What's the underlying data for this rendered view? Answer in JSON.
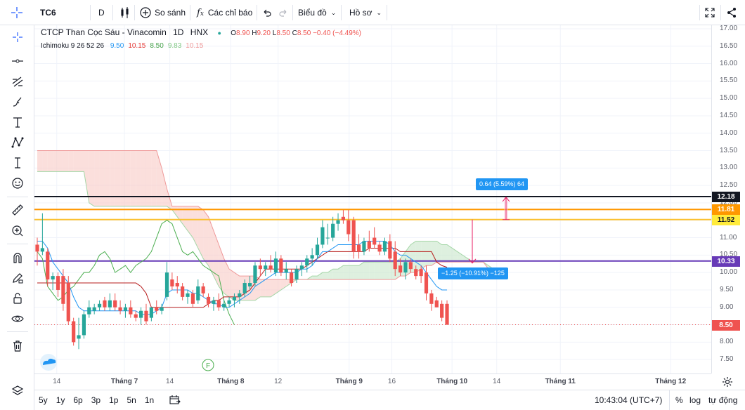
{
  "toolbar": {
    "symbol": "TC6",
    "interval": "D",
    "compare_label": "So sánh",
    "indicators_label": "Các chỉ báo",
    "chart_menu_label": "Biểu đồ",
    "profile_menu_label": "Hồ sơ"
  },
  "legend": {
    "title": "CTCP Than Cọc Sáu - Vinacomin",
    "interval": "1D",
    "exchange": "HNX",
    "ohlc": {
      "o_key": "O",
      "o": "8.90",
      "h_key": "H",
      "h": "9.20",
      "l_key": "L",
      "l": "8.50",
      "c_key": "C",
      "c": "8.50",
      "change": "−0.40 (−4.49%)"
    },
    "indicator_name": "Ichimoku 9 26 52 26",
    "indicator_values": [
      "9.50",
      "10.15",
      "8.50",
      "9.83",
      "10.15"
    ],
    "indicator_colors": [
      "#2196f3",
      "#e53935",
      "#43a047",
      "#81c784",
      "#ef9a9a"
    ]
  },
  "colors": {
    "up": "#26a69a",
    "down": "#ef5350",
    "conversion_line": "#2196f3",
    "base_line": "#b71c1c",
    "lagging_span": "#4caf50",
    "cloud_bear": "#f8c9c4",
    "cloud_bull": "#c8e6c9",
    "line_black": "#131722",
    "line_orange": "#ff9800",
    "line_yellow": "#ffeb3b",
    "line_purple": "#673ab7",
    "measure_blue": "#2196f3",
    "measure_pink": "#e91e63"
  },
  "chart_data": {
    "type": "candlestick",
    "symbol": "TC6",
    "ylim": [
      7.1,
      17.1
    ],
    "price_ticks": [
      "17.00",
      "16.50",
      "16.00",
      "15.50",
      "15.00",
      "14.50",
      "14.00",
      "13.50",
      "13.00",
      "12.50",
      "12.00",
      "11.50",
      "11.00",
      "10.50",
      "10.00",
      "9.50",
      "9.00",
      "8.50",
      "8.00",
      "7.50"
    ],
    "time_labels": [
      "14",
      "Tháng 7",
      "14",
      "Tháng 8",
      "12",
      "Tháng 9",
      "16",
      "Tháng 10",
      "14",
      "Tháng 11",
      "Tháng 12"
    ],
    "horizontal_lines": [
      {
        "price": 12.18,
        "label": "12.18",
        "color": "#131722"
      },
      {
        "price": 11.81,
        "label": "11.81",
        "color": "#ff9800"
      },
      {
        "price": 11.52,
        "label": "11.52",
        "color": "#fbc02d"
      },
      {
        "price": 10.33,
        "label": "10.33",
        "color": "#673ab7"
      }
    ],
    "last_price": {
      "price": 8.5,
      "label": "8.50"
    },
    "measurements": [
      {
        "label": "0.64 (5.59%) 64",
        "from": 11.52,
        "to": 12.16
      },
      {
        "label": "−1.25 (−10.91%) −125",
        "from": 11.52,
        "to": 10.27
      }
    ],
    "candles": [
      {
        "o": 10.8,
        "h": 11.0,
        "l": 10.2,
        "c": 10.6
      },
      {
        "o": 10.6,
        "h": 11.7,
        "l": 10.5,
        "c": 10.7
      },
      {
        "o": 10.6,
        "h": 10.7,
        "l": 9.6,
        "c": 9.8
      },
      {
        "o": 9.8,
        "h": 10.0,
        "l": 9.5,
        "c": 9.9
      },
      {
        "o": 9.9,
        "h": 10.0,
        "l": 9.3,
        "c": 9.5
      },
      {
        "o": 9.9,
        "h": 10.1,
        "l": 8.9,
        "c": 9.1
      },
      {
        "o": 9.7,
        "h": 9.9,
        "l": 8.5,
        "c": 8.6
      },
      {
        "o": 8.6,
        "h": 8.7,
        "l": 7.9,
        "c": 8.0
      },
      {
        "o": 8.1,
        "h": 8.7,
        "l": 7.8,
        "c": 8.2
      },
      {
        "o": 8.2,
        "h": 8.9,
        "l": 8.1,
        "c": 8.8
      },
      {
        "o": 8.8,
        "h": 9.2,
        "l": 8.7,
        "c": 9.0
      },
      {
        "o": 8.9,
        "h": 9.1,
        "l": 8.8,
        "c": 9.0
      },
      {
        "o": 9.0,
        "h": 9.2,
        "l": 8.9,
        "c": 9.1
      },
      {
        "o": 9.2,
        "h": 9.3,
        "l": 8.9,
        "c": 9.0
      },
      {
        "o": 9.0,
        "h": 9.4,
        "l": 8.9,
        "c": 9.2
      },
      {
        "o": 9.2,
        "h": 9.4,
        "l": 8.9,
        "c": 9.0
      },
      {
        "o": 9.0,
        "h": 9.2,
        "l": 8.8,
        "c": 8.9
      },
      {
        "o": 8.9,
        "h": 9.1,
        "l": 8.7,
        "c": 9.0
      },
      {
        "o": 9.0,
        "h": 9.2,
        "l": 8.7,
        "c": 8.8
      },
      {
        "o": 8.8,
        "h": 8.9,
        "l": 8.6,
        "c": 8.7
      },
      {
        "o": 8.7,
        "h": 9.0,
        "l": 8.5,
        "c": 8.9
      },
      {
        "o": 8.9,
        "h": 9.1,
        "l": 8.5,
        "c": 8.6
      },
      {
        "o": 8.7,
        "h": 9.0,
        "l": 8.6,
        "c": 9.0
      },
      {
        "o": 9.0,
        "h": 9.2,
        "l": 8.8,
        "c": 8.9
      },
      {
        "o": 8.9,
        "h": 9.1,
        "l": 8.8,
        "c": 9.0
      },
      {
        "o": 9.3,
        "h": 10.3,
        "l": 9.2,
        "c": 10.0
      },
      {
        "o": 9.8,
        "h": 10.0,
        "l": 9.5,
        "c": 9.6
      },
      {
        "o": 9.7,
        "h": 9.9,
        "l": 9.4,
        "c": 9.6
      },
      {
        "o": 9.6,
        "h": 9.7,
        "l": 9.2,
        "c": 9.3
      },
      {
        "o": 9.3,
        "h": 9.5,
        "l": 9.1,
        "c": 9.4
      },
      {
        "o": 9.4,
        "h": 9.5,
        "l": 9.0,
        "c": 9.1
      },
      {
        "o": 9.2,
        "h": 9.8,
        "l": 9.1,
        "c": 9.6
      },
      {
        "o": 9.6,
        "h": 9.7,
        "l": 9.3,
        "c": 9.4
      },
      {
        "o": 9.3,
        "h": 9.4,
        "l": 9.0,
        "c": 9.1
      },
      {
        "o": 9.1,
        "h": 9.3,
        "l": 8.9,
        "c": 9.2
      },
      {
        "o": 9.2,
        "h": 9.4,
        "l": 8.9,
        "c": 9.0
      },
      {
        "o": 9.0,
        "h": 9.2,
        "l": 8.9,
        "c": 9.1
      },
      {
        "o": 9.1,
        "h": 9.3,
        "l": 9.0,
        "c": 9.2
      },
      {
        "o": 9.2,
        "h": 9.4,
        "l": 9.0,
        "c": 9.3
      },
      {
        "o": 9.3,
        "h": 9.5,
        "l": 9.1,
        "c": 9.4
      },
      {
        "o": 9.4,
        "h": 9.8,
        "l": 9.3,
        "c": 9.7
      },
      {
        "o": 9.6,
        "h": 9.9,
        "l": 9.5,
        "c": 9.7
      },
      {
        "o": 9.7,
        "h": 10.3,
        "l": 9.6,
        "c": 10.2
      },
      {
        "o": 10.2,
        "h": 10.4,
        "l": 9.9,
        "c": 10.1
      },
      {
        "o": 10.1,
        "h": 10.3,
        "l": 9.9,
        "c": 10.2
      },
      {
        "o": 10.2,
        "h": 10.5,
        "l": 10.0,
        "c": 10.1
      },
      {
        "o": 10.0,
        "h": 10.6,
        "l": 9.9,
        "c": 10.4
      },
      {
        "o": 10.4,
        "h": 10.5,
        "l": 9.9,
        "c": 10.0
      },
      {
        "o": 10.0,
        "h": 10.3,
        "l": 9.8,
        "c": 10.1
      },
      {
        "o": 10.0,
        "h": 10.1,
        "l": 9.6,
        "c": 9.7
      },
      {
        "o": 9.8,
        "h": 10.2,
        "l": 9.7,
        "c": 10.1
      },
      {
        "o": 10.1,
        "h": 10.3,
        "l": 9.9,
        "c": 10.2
      },
      {
        "o": 10.2,
        "h": 10.5,
        "l": 10.0,
        "c": 10.4
      },
      {
        "o": 10.4,
        "h": 10.7,
        "l": 10.2,
        "c": 10.5
      },
      {
        "o": 10.5,
        "h": 11.0,
        "l": 10.4,
        "c": 10.8
      },
      {
        "o": 10.8,
        "h": 11.5,
        "l": 10.7,
        "c": 11.3
      },
      {
        "o": 11.0,
        "h": 11.4,
        "l": 10.8,
        "c": 11.0
      },
      {
        "o": 11.0,
        "h": 11.6,
        "l": 10.9,
        "c": 11.4
      },
      {
        "o": 11.4,
        "h": 11.7,
        "l": 11.2,
        "c": 11.5
      },
      {
        "o": 11.6,
        "h": 11.8,
        "l": 11.4,
        "c": 11.5
      },
      {
        "o": 11.5,
        "h": 11.8,
        "l": 10.9,
        "c": 11.1
      },
      {
        "o": 11.5,
        "h": 11.6,
        "l": 10.4,
        "c": 10.6
      },
      {
        "o": 10.8,
        "h": 11.1,
        "l": 10.4,
        "c": 10.6
      },
      {
        "o": 10.6,
        "h": 11.0,
        "l": 10.5,
        "c": 10.9
      },
      {
        "o": 10.9,
        "h": 11.2,
        "l": 10.6,
        "c": 10.7
      },
      {
        "o": 11.0,
        "h": 11.3,
        "l": 10.7,
        "c": 10.8
      },
      {
        "o": 10.8,
        "h": 10.9,
        "l": 10.5,
        "c": 10.6
      },
      {
        "o": 10.6,
        "h": 11.0,
        "l": 10.5,
        "c": 10.9
      },
      {
        "o": 10.9,
        "h": 11.1,
        "l": 10.3,
        "c": 10.4
      },
      {
        "o": 10.6,
        "h": 10.9,
        "l": 9.9,
        "c": 10.1
      },
      {
        "o": 10.2,
        "h": 10.4,
        "l": 9.9,
        "c": 10.0
      },
      {
        "o": 10.0,
        "h": 10.4,
        "l": 9.8,
        "c": 10.3
      },
      {
        "o": 10.3,
        "h": 10.4,
        "l": 10.0,
        "c": 10.1
      },
      {
        "o": 10.1,
        "h": 10.2,
        "l": 9.8,
        "c": 9.9
      },
      {
        "o": 10.1,
        "h": 10.2,
        "l": 9.7,
        "c": 9.9
      },
      {
        "o": 10.0,
        "h": 10.2,
        "l": 9.2,
        "c": 9.4
      },
      {
        "o": 9.4,
        "h": 9.5,
        "l": 8.9,
        "c": 9.1
      },
      {
        "o": 9.2,
        "h": 9.3,
        "l": 9.0,
        "c": 9.0
      },
      {
        "o": 9.1,
        "h": 9.2,
        "l": 8.6,
        "c": 8.7
      },
      {
        "o": 9.1,
        "h": 9.2,
        "l": 8.5,
        "c": 8.5
      }
    ],
    "conversion_line": [
      10.9,
      10.9,
      10.7,
      10.3,
      10.1,
      9.9,
      9.7,
      9.3,
      9.0,
      8.9,
      8.9,
      8.9,
      8.9,
      8.9,
      8.9,
      8.9,
      8.9,
      8.9,
      8.9,
      8.9,
      8.8,
      8.8,
      8.8,
      8.9,
      9.0,
      9.4,
      9.5,
      9.5,
      9.5,
      9.5,
      9.4,
      9.4,
      9.3,
      9.2,
      9.1,
      9.1,
      9.0,
      9.0,
      9.1,
      9.2,
      9.3,
      9.4,
      9.6,
      9.7,
      9.8,
      9.9,
      10.0,
      10.0,
      10.0,
      10.0,
      10.0,
      10.1,
      10.1,
      10.2,
      10.4,
      10.6,
      10.6,
      10.7,
      10.8,
      10.8,
      10.8,
      10.8,
      10.8,
      10.9,
      10.9,
      10.9,
      10.9,
      10.9,
      10.8,
      10.6,
      10.5,
      10.5,
      10.4,
      10.3,
      10.2,
      10.0,
      9.8,
      9.6,
      9.5,
      9.5
    ],
    "base_line": [
      9.7,
      9.7,
      9.7,
      9.7,
      9.7,
      9.7,
      9.7,
      9.7,
      9.7,
      9.7,
      9.7,
      9.7,
      9.7,
      9.7,
      9.7,
      9.7,
      9.7,
      9.7,
      9.7,
      9.7,
      9.6,
      9.4,
      9.0,
      9.0,
      9.0,
      9.0,
      9.0,
      9.0,
      9.0,
      9.0,
      9.0,
      9.0,
      9.0,
      9.1,
      9.2,
      9.2,
      9.3,
      9.3,
      9.3,
      9.3,
      9.4,
      9.5,
      9.7,
      9.9,
      10.1,
      10.1,
      10.1,
      10.1,
      10.1,
      10.1,
      10.1,
      10.1,
      10.2,
      10.3,
      10.4,
      10.5,
      10.6,
      10.6,
      10.6,
      10.6,
      10.6,
      10.6,
      10.6,
      10.6,
      10.7,
      10.7,
      10.7,
      10.7,
      10.7,
      10.7,
      10.6,
      10.6,
      10.6,
      10.6,
      10.6,
      10.6,
      10.6,
      10.3,
      10.2,
      10.15
    ],
    "lagging_span": [
      10.6,
      10.4,
      9.6,
      9.4,
      9.2,
      9.3,
      9.5,
      9.6,
      9.8,
      10.0,
      10.0,
      10.2,
      10.5,
      10.6,
      10.4,
      10.0,
      10.1,
      10.2,
      10.0,
      10.2,
      10.3,
      10.4,
      10.6,
      11.0,
      11.4,
      11.5,
      11.4,
      11.0,
      10.6,
      10.5,
      10.6,
      10.4,
      10.2,
      10.1,
      10.0,
      9.9,
      9.2,
      8.8,
      8.5
    ],
    "span_a": [
      12.9,
      12.9,
      12.9,
      12.9,
      12.9,
      12.9,
      12.9,
      12.9,
      12.9,
      12.9,
      12.0,
      11.9,
      11.9,
      11.9,
      11.9,
      11.9,
      11.9,
      11.9,
      11.9,
      11.9,
      11.9,
      11.9,
      11.9,
      11.9,
      11.9,
      11.9,
      11.8,
      11.6,
      11.4,
      11.2,
      11.0,
      10.7,
      10.4,
      10.2,
      9.9,
      9.6,
      9.4,
      9.3,
      9.2,
      9.2,
      9.2,
      9.2,
      9.2,
      9.3,
      9.3,
      9.3,
      9.4,
      9.5,
      9.6,
      9.7,
      9.8,
      9.8,
      9.8,
      9.9,
      9.9,
      10.0,
      10.0,
      10.1,
      10.1,
      10.2,
      10.2,
      10.2,
      10.2,
      10.3,
      10.3,
      10.3,
      10.3,
      10.3,
      10.3,
      10.3,
      10.4,
      10.6,
      10.8,
      10.9,
      10.9,
      10.9,
      10.9,
      10.9,
      10.8,
      10.8,
      10.7,
      10.6,
      10.5,
      10.4,
      10.3,
      10.3,
      10.3,
      10.2,
      10.1
    ],
    "span_b": [
      13.5,
      13.5,
      13.5,
      13.5,
      13.5,
      13.5,
      13.5,
      13.5,
      13.5,
      13.5,
      13.5,
      13.5,
      13.5,
      13.5,
      13.5,
      13.5,
      13.5,
      13.5,
      13.5,
      13.5,
      13.5,
      13.5,
      13.5,
      13.5,
      13.0,
      12.4,
      11.9,
      11.9,
      11.9,
      11.9,
      11.9,
      11.9,
      11.8,
      11.6,
      11.2,
      10.8,
      10.4,
      10.1,
      10.0,
      9.9,
      9.9,
      9.9,
      9.9,
      9.8,
      9.8,
      9.8,
      9.8,
      9.8,
      9.8,
      9.8,
      9.8,
      9.8,
      9.8,
      9.8,
      9.8,
      9.8,
      9.8,
      9.8,
      9.8,
      9.8,
      9.8,
      9.8,
      9.8,
      9.8,
      9.8,
      9.8,
      9.8,
      9.8,
      9.8,
      9.8,
      9.9,
      9.9,
      10.0,
      10.0,
      10.1,
      10.2,
      10.2,
      10.3,
      10.3,
      10.3,
      10.3,
      10.3,
      10.3,
      10.3,
      10.3,
      10.3,
      10.3,
      10.1,
      10.0
    ]
  },
  "left_tools": [
    "crosshair-icon",
    "trend-line-icon",
    "fib-icon",
    "brush-icon",
    "text-icon",
    "pattern-icon",
    "measure-icon",
    "emoji-icon",
    "ruler-icon",
    "zoom-icon",
    "magnet-icon",
    "lock-drawing-icon",
    "lock-icon",
    "eye-icon",
    "trash-icon",
    "layers-icon"
  ],
  "bottom": {
    "ranges": [
      "5y",
      "1y",
      "6p",
      "3p",
      "1p",
      "5n",
      "1n"
    ],
    "time": "10:43:04 (UTC+7)",
    "percent": "%",
    "log": "log",
    "auto": "tự động"
  },
  "marker_f": "F"
}
